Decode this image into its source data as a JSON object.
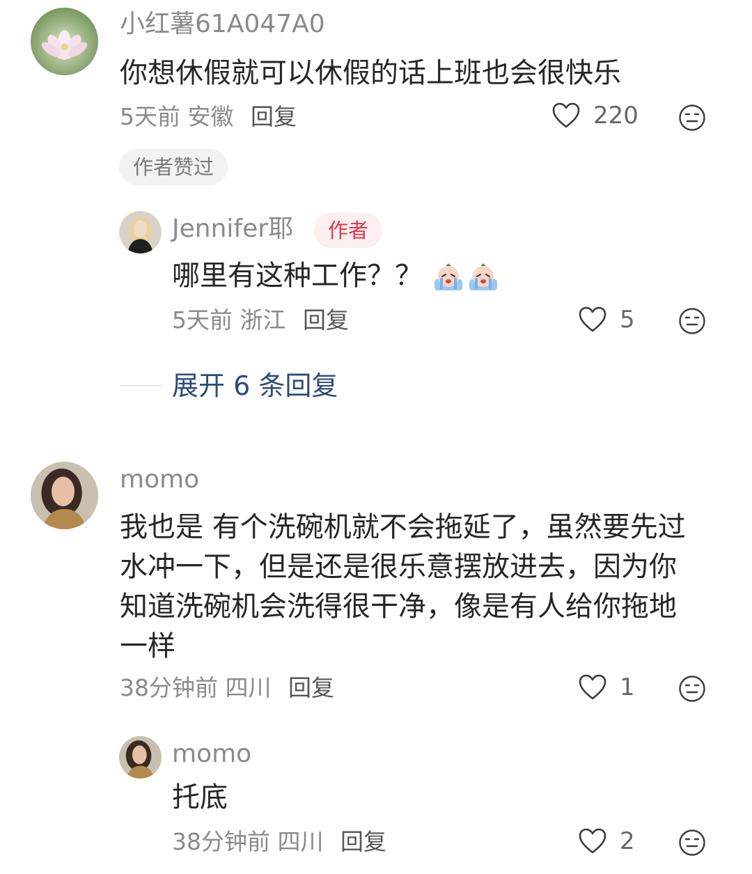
{
  "comments": [
    {
      "user": "小红薯61A047A0",
      "text": "你想休假就可以休假的话上班也会很快乐",
      "time": "5天前",
      "location": "安徽",
      "reply_label": "回复",
      "likes": "220",
      "badge": "作者赞过",
      "replies": [
        {
          "user": "Jennifer耶",
          "author_tag": "作者",
          "text": "哪里有这种工作？？",
          "time": "5天前",
          "location": "浙江",
          "reply_label": "回复",
          "likes": "5"
        }
      ],
      "expand_label": "展开 6 条回复"
    },
    {
      "user": "momo",
      "text_lines": [
        "我也是 有个洗碗机就不会拖延了，虽然要先过",
        "水冲一下，但是还是很乐意摆放进去，因为你",
        "知道洗碗机会洗得很干净，像是有人给你拖地",
        "一样"
      ],
      "time": "38分钟前",
      "location": "四川",
      "reply_label": "回复",
      "likes": "1",
      "replies": [
        {
          "user": "momo",
          "text": "托底",
          "time": "38分钟前",
          "location": "四川",
          "reply_label": "回复",
          "likes": "2"
        }
      ]
    }
  ],
  "icons": {
    "like": "heart-outline-icon",
    "dislike": "meh-face-icon",
    "emoji": "crying-face-sticker-icon"
  },
  "colors": {
    "author_tag": "#e5344a",
    "expand_link": "#2e4a7a",
    "meta": "#8a8a8a"
  }
}
